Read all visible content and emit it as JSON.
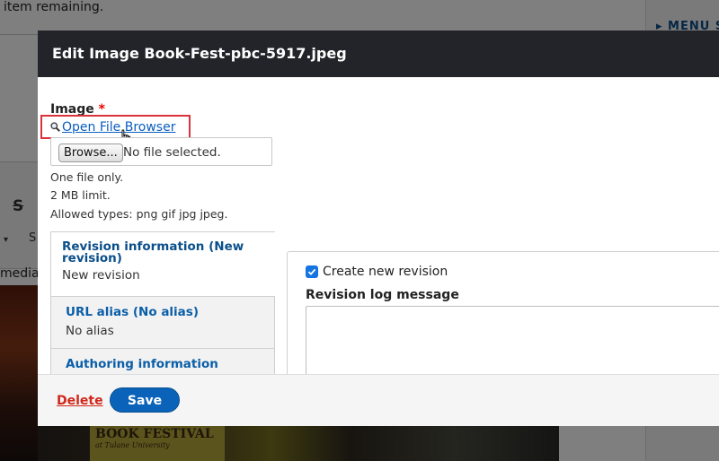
{
  "background": {
    "top_message": "item remaining.",
    "right_menu": "▸ MENU S",
    "editor_strike_glyph": "S",
    "editor_glyphs": [
      "▾",
      "S"
    ],
    "media_label": "media",
    "poster_title": "BOOK FESTIVAL",
    "poster_subtitle": "at Tulane University"
  },
  "dialog": {
    "title": "Edit Image Book-Fest-pbc-5917.jpeg",
    "image_field": {
      "label": "Image",
      "required_marker": "*",
      "open_file_browser": "Open File Browser",
      "browse_button": "Browse...",
      "no_file_text": "No file selected.",
      "help": [
        "One file only.",
        "2 MB limit.",
        "Allowed types: png gif jpg jpeg."
      ]
    },
    "vertical_tabs": [
      {
        "title": "Revision information (New revision)",
        "summary": "New revision"
      },
      {
        "title": "URL alias (No alias)",
        "summary": "No alias"
      },
      {
        "title": "Authoring information",
        "summary": ""
      }
    ],
    "revision_pane": {
      "create_revision_label": "Create new revision",
      "create_revision_checked": true,
      "log_message_label": "Revision log message",
      "log_message_value": ""
    },
    "footer": {
      "delete_label": "Delete",
      "save_label": "Save"
    }
  },
  "colors": {
    "header_bg": "#232429",
    "link": "#0a5ec0",
    "highlight_box": "#d9323a",
    "delete": "#d0271a",
    "save_button": "#0b63b9",
    "checkbox": "#1474e0"
  },
  "icons": [
    "magnifier-icon",
    "pointer-hand-cursor-icon",
    "checkmark-icon",
    "menu-arrow-icon"
  ]
}
